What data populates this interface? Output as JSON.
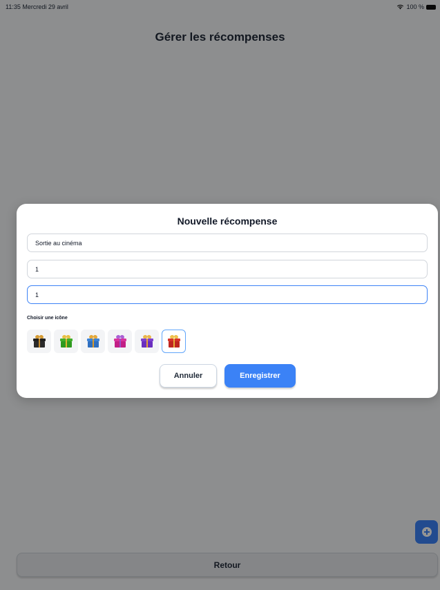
{
  "status_bar": {
    "time_date": "11:35  Mercredi 29 avril",
    "battery": "100 %"
  },
  "page": {
    "title": "Gérer les récompenses",
    "back_label": "Retour",
    "fab_icon": "plus-circle-icon"
  },
  "modal": {
    "title": "Nouvelle récompense",
    "name_value": "Sortie au cinéma",
    "field2_value": "1",
    "field3_value": "1",
    "icon_label": "Choisir une icône",
    "icons": [
      {
        "name": "gift-black-icon",
        "lid": "#1f1f1f",
        "box": "#2a2a2a",
        "ribbon": "#c68a2b",
        "bow": "#d49a33"
      },
      {
        "name": "gift-green-icon",
        "lid": "#3fae2a",
        "box": "#2f9a1f",
        "ribbon": "#e0b431",
        "bow": "#e6c044"
      },
      {
        "name": "gift-blue-icon",
        "lid": "#3b82d6",
        "box": "#2f6fc0",
        "ribbon": "#d99a2d",
        "bow": "#e4a83a"
      },
      {
        "name": "gift-magenta-icon",
        "lid": "#d9339c",
        "box": "#c21f86",
        "ribbon": "#9a4fc9",
        "bow": "#a95fd4"
      },
      {
        "name": "gift-purple-icon",
        "lid": "#7c3fcf",
        "box": "#6a2fbf",
        "ribbon": "#e8a53a",
        "bow": "#eab44a"
      },
      {
        "name": "gift-red-icon",
        "lid": "#d6322b",
        "box": "#bf2620",
        "ribbon": "#e6b03a",
        "bow": "#eec04c"
      }
    ],
    "selected_icon_index": 5,
    "cancel_label": "Annuler",
    "save_label": "Enregistrer"
  },
  "colors": {
    "accent": "#3b82f6",
    "overlay": "rgba(0,0,0,0.42)"
  }
}
